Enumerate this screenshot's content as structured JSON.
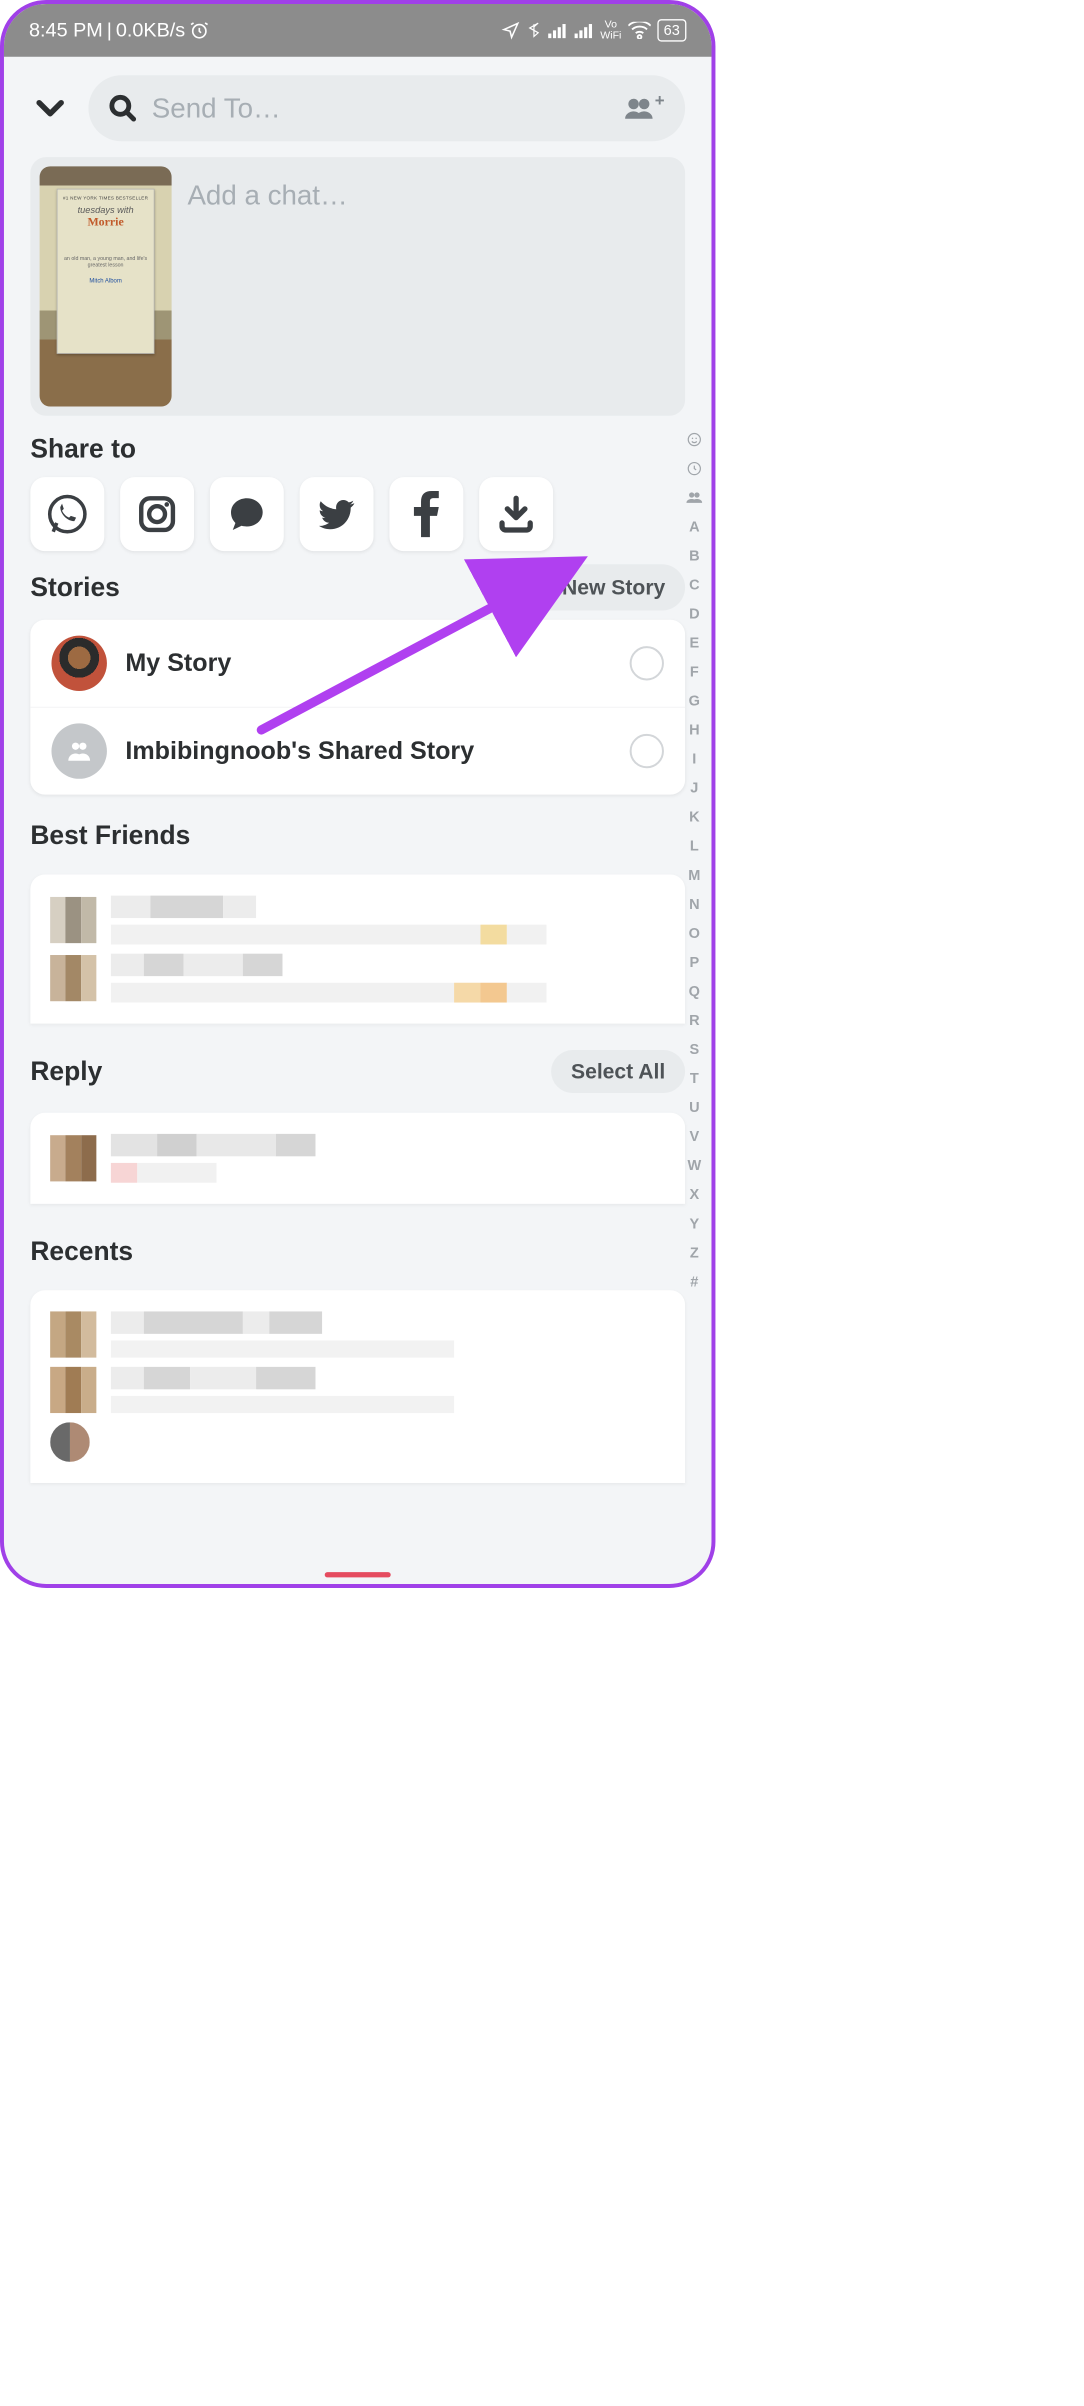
{
  "status": {
    "time": "8:45 PM",
    "speed": "0.0KB/s",
    "battery": "63",
    "wifi_label": "Vo WiFi"
  },
  "search": {
    "placeholder": "Send To…"
  },
  "chat_box": {
    "placeholder": "Add a chat…",
    "book": {
      "banner": "#1 NEW YORK TIMES BESTSELLER",
      "line1": "tuesdays with",
      "line2": "Morrie",
      "sub": "an old man, a young man, and life's greatest lesson",
      "author": "Mitch Albom"
    }
  },
  "sections": {
    "share_to": "Share to",
    "stories": "Stories",
    "best_friends": "Best Friends",
    "reply": "Reply",
    "recents": "Recents"
  },
  "share_icons": [
    "whatsapp",
    "instagram",
    "messages",
    "twitter",
    "facebook",
    "download"
  ],
  "stories": {
    "new_story": "New Story",
    "items": [
      {
        "label": "My Story"
      },
      {
        "label": "Imbibingnoob's Shared Story"
      }
    ]
  },
  "reply": {
    "select_all": "Select All"
  },
  "alpha_index": [
    "A",
    "B",
    "C",
    "D",
    "E",
    "F",
    "G",
    "H",
    "I",
    "J",
    "K",
    "L",
    "M",
    "N",
    "O",
    "P",
    "Q",
    "R",
    "S",
    "T",
    "U",
    "V",
    "W",
    "X",
    "Y",
    "Z",
    "#"
  ]
}
